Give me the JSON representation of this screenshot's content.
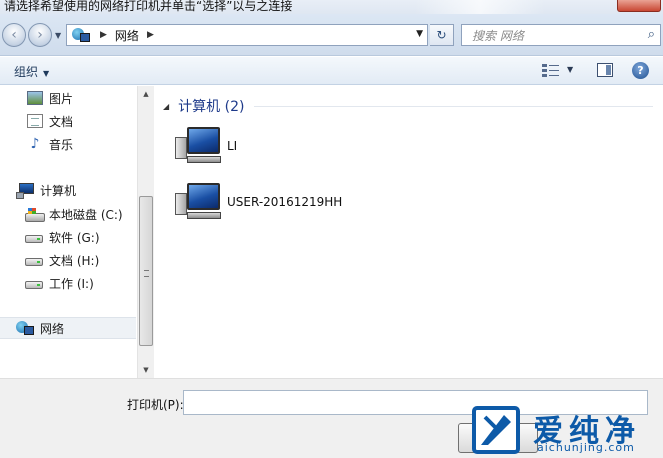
{
  "window": {
    "title": "请选择希望使用的网络打印机并单击“选择”以与之连接"
  },
  "nav": {
    "back_glyph": "‹",
    "forward_glyph": "›",
    "address": {
      "root_sep": "▶",
      "crumb": "网络",
      "trail_sep": "▶",
      "dropdown_glyph": "▼"
    },
    "refresh_glyph": "↻",
    "search": {
      "placeholder": "搜索 网络",
      "icon": "search-icon"
    }
  },
  "toolbar": {
    "organize_label": "组织",
    "organize_caret": "▼",
    "views_caret": "▼",
    "help_glyph": "?"
  },
  "sidebar": {
    "libraries": [
      {
        "label": "图片",
        "icon": "pictures-icon"
      },
      {
        "label": "文档",
        "icon": "documents-icon"
      },
      {
        "label": "音乐",
        "icon": "music-icon"
      }
    ],
    "computer": {
      "label": "计算机",
      "icon": "computer-icon",
      "drives": [
        {
          "label": "本地磁盘 (C:)",
          "icon": "system-drive-icon"
        },
        {
          "label": "软件 (G:)",
          "icon": "drive-icon"
        },
        {
          "label": "文档 (H:)",
          "icon": "drive-icon"
        },
        {
          "label": "工作 (I:)",
          "icon": "drive-icon"
        }
      ]
    },
    "network": {
      "label": "网络",
      "icon": "network-icon"
    }
  },
  "content": {
    "group_title": "计算机 (2)",
    "items": [
      {
        "name": "LI",
        "icon": "computer-icon"
      },
      {
        "name": "USER-20161219HH",
        "icon": "computer-icon"
      }
    ]
  },
  "footer": {
    "printer_label": "打印机(P):",
    "printer_value": ""
  },
  "watermark": {
    "brand": "爱纯净",
    "domain": "aichunjing.com",
    "color": "#0d5aa8"
  },
  "colors": {
    "accent": "#1e3a8a",
    "toolbar_bg": "#e2ebf5",
    "close_red": "#c84733"
  }
}
